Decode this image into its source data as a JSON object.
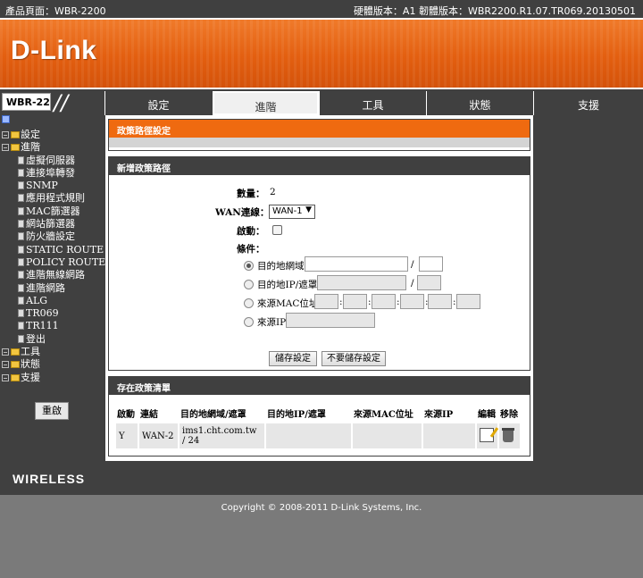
{
  "topbar": {
    "product": "產品頁面：WBR-2200",
    "versions": "硬體版本：A1   韌體版本：WBR2200.R1.07.TR069.20130501"
  },
  "brand": {
    "logo": "D-Link",
    "model": "WBR-2200",
    "footer": "WIRELESS"
  },
  "tabs": [
    {
      "label": "設定"
    },
    {
      "label": "進階"
    },
    {
      "label": "工具"
    },
    {
      "label": "狀態"
    },
    {
      "label": "支援"
    }
  ],
  "sidebar": {
    "items": [
      {
        "label": "設定"
      },
      {
        "label": "進階"
      },
      {
        "label": "虛擬伺服器"
      },
      {
        "label": "連接埠轉發"
      },
      {
        "label": "SNMP"
      },
      {
        "label": "應用程式規則"
      },
      {
        "label": "MAC篩選器"
      },
      {
        "label": "網站篩選器"
      },
      {
        "label": "防火牆設定"
      },
      {
        "label": "STATIC ROUTE"
      },
      {
        "label": "POLICY ROUTE"
      },
      {
        "label": "進階無線網路"
      },
      {
        "label": "進階網路"
      },
      {
        "label": "ALG"
      },
      {
        "label": "TR069"
      },
      {
        "label": "TR111"
      },
      {
        "label": "登出"
      },
      {
        "label": "工具"
      },
      {
        "label": "狀態"
      },
      {
        "label": "支援"
      }
    ],
    "reboot": "重啟"
  },
  "section1": {
    "title": "政策路徑設定"
  },
  "section2": {
    "title": "新增政策路徑",
    "count_label": "數量：",
    "count_value": "2",
    "wan_label": "WAN連線：",
    "wan_selected": "WAN-1",
    "enable_label": "啟動：",
    "condition_label": "條件：",
    "dest_domain": "目的地網域",
    "dest_ip": "目的地IP/遮罩",
    "src_mac": "來源MAC位址",
    "src_ip": "來源IP",
    "slash": "/",
    "colon": ":",
    "save": "儲存設定",
    "nosave": "不要儲存設定"
  },
  "section3": {
    "title": "存在政策清單",
    "headers": [
      "啟動",
      "連結",
      "目的地網域/遮罩",
      "目的地IP/遮罩",
      "來源MAC位址",
      "來源IP",
      "編輯",
      "移除"
    ],
    "rows": [
      {
        "enable": "Y",
        "link": "WAN-2",
        "domain": "ims1.cht.com.tw / 24",
        "dest_ip": "",
        "src_mac": "",
        "src_ip": ""
      }
    ]
  },
  "copyright": "Copyright © 2008-2011 D-Link Systems, Inc."
}
